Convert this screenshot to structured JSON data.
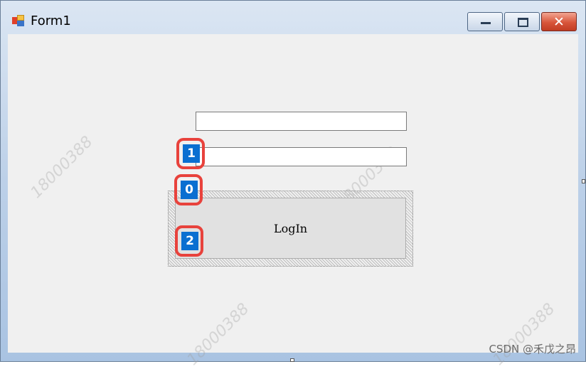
{
  "window": {
    "title": "Form1",
    "icon": "winforms-app-icon"
  },
  "controls": {
    "minimize_icon": "minimize-icon",
    "maximize_icon": "maximize-icon",
    "close_icon": "close-icon",
    "close_glyph": "✕"
  },
  "form": {
    "textbox1": {
      "value": ""
    },
    "textbox2": {
      "value": ""
    },
    "login_button": {
      "label": "LogIn"
    }
  },
  "annotations": [
    {
      "number": "1"
    },
    {
      "number": "0"
    },
    {
      "number": "2"
    }
  ],
  "watermarks": [
    "18000388",
    "18000388",
    "18000388",
    "18000388"
  ],
  "footer": {
    "credit": "CSDN @禾戊之昂"
  },
  "colors": {
    "annotation_border": "#e8423c",
    "annotation_fill": "#0a6fd1",
    "client_bg": "#f0f0f0"
  }
}
